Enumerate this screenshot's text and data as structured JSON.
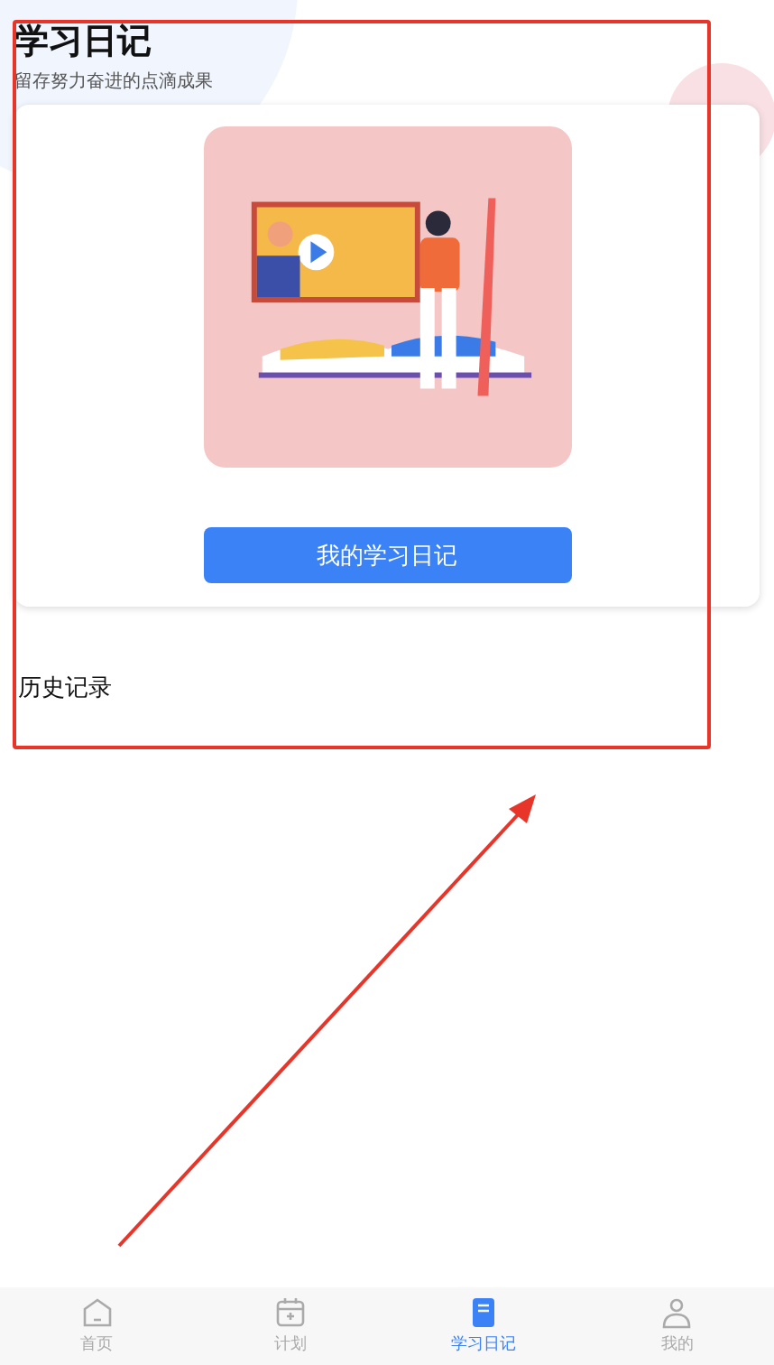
{
  "header": {
    "title": "学习日记",
    "subtitle": "留存努力奋进的点滴成果"
  },
  "card": {
    "button": "我的学习日记"
  },
  "history": {
    "title": "历史记录"
  },
  "tabs": [
    {
      "kind": "home",
      "label": "首页",
      "selected": false
    },
    {
      "kind": "calendar",
      "label": "计划",
      "selected": false
    },
    {
      "kind": "diary",
      "label": "学习日记",
      "selected": true
    },
    {
      "kind": "profile",
      "label": "我的",
      "selected": false
    }
  ]
}
